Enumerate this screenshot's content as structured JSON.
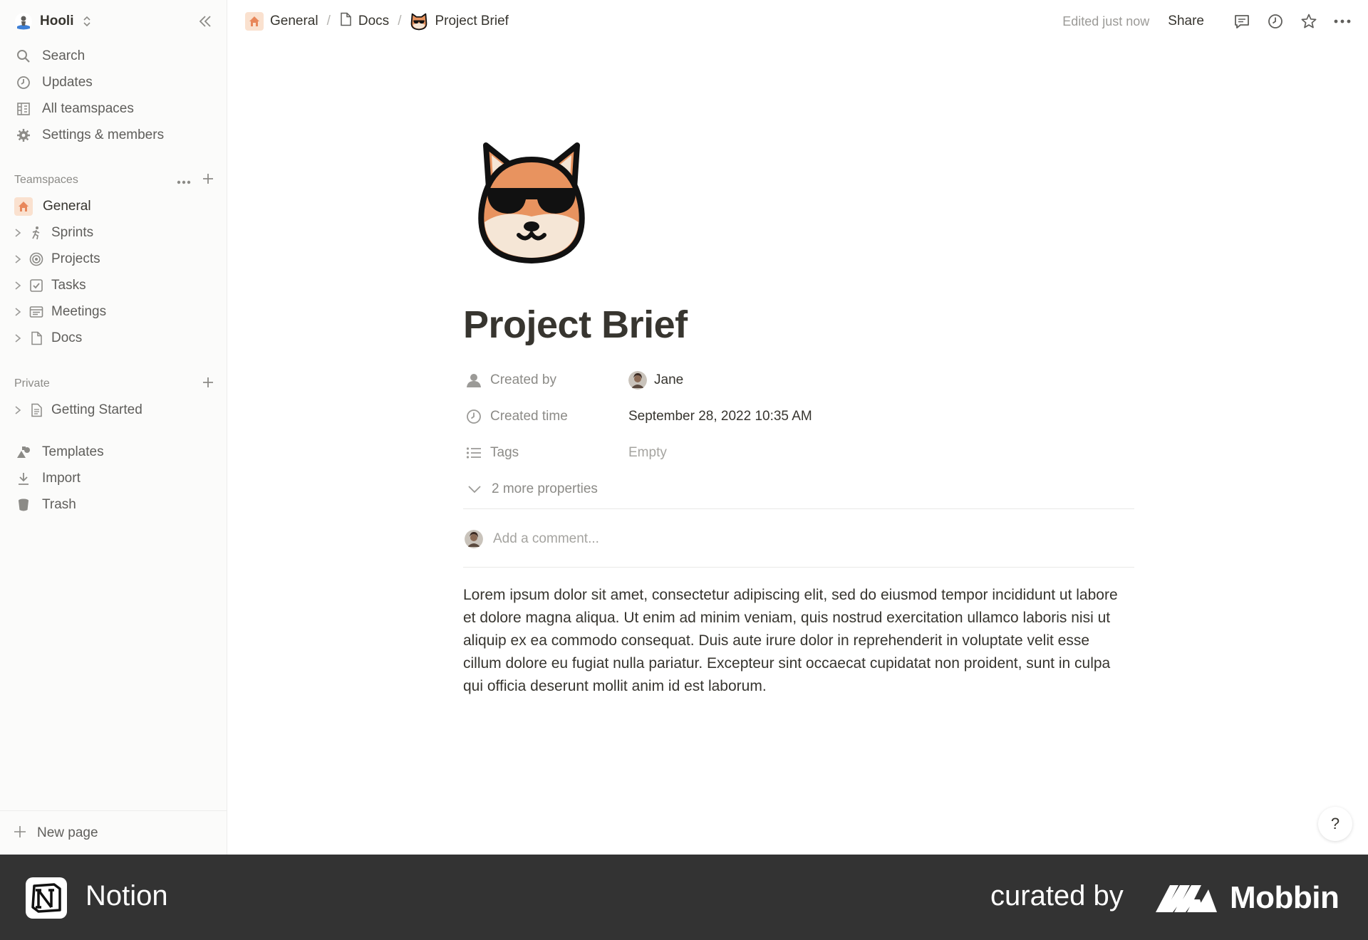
{
  "workspace": {
    "name": "Hooli"
  },
  "sidebar": {
    "nav": [
      {
        "label": "Search",
        "icon": "search-icon"
      },
      {
        "label": "Updates",
        "icon": "clock-icon"
      },
      {
        "label": "All teamspaces",
        "icon": "building-icon"
      },
      {
        "label": "Settings & members",
        "icon": "gear-icon"
      }
    ],
    "teamspaces_label": "Teamspaces",
    "teamspaces": [
      {
        "label": "General",
        "icon": "home-icon",
        "active": true
      },
      {
        "label": "Sprints",
        "icon": "runner-icon"
      },
      {
        "label": "Projects",
        "icon": "target-icon"
      },
      {
        "label": "Tasks",
        "icon": "checkbox-icon"
      },
      {
        "label": "Meetings",
        "icon": "notes-icon"
      },
      {
        "label": "Docs",
        "icon": "page-icon"
      }
    ],
    "private_label": "Private",
    "private": [
      {
        "label": "Getting Started",
        "icon": "doc-icon"
      }
    ],
    "bottom": [
      {
        "label": "Templates",
        "icon": "shapes-icon"
      },
      {
        "label": "Import",
        "icon": "download-icon"
      },
      {
        "label": "Trash",
        "icon": "trash-icon"
      }
    ],
    "new_page": "New page"
  },
  "topbar": {
    "breadcrumbs": [
      "General",
      "Docs",
      "Project Brief"
    ],
    "edited": "Edited just now",
    "share": "Share"
  },
  "page": {
    "title": "Project Brief",
    "properties": [
      {
        "key": "Created by",
        "value": "Jane",
        "icon": "person-icon"
      },
      {
        "key": "Created time",
        "value": "September 28, 2022 10:35 AM",
        "icon": "clock-icon"
      },
      {
        "key": "Tags",
        "value": "Empty",
        "icon": "list-icon"
      }
    ],
    "more_properties": "2 more properties",
    "comment_placeholder": "Add a comment...",
    "body": "Lorem ipsum dolor sit amet, consectetur adipiscing elit, sed do eiusmod tempor incididunt ut labore et dolore magna aliqua. Ut enim ad minim veniam, quis nostrud exercitation ullamco laboris nisi ut aliquip ex ea commodo consequat. Duis aute irure dolor in reprehenderit in voluptate velit esse cillum dolore eu fugiat nulla pariatur. Excepteur sint occaecat cupidatat non proident, sunt in culpa qui officia deserunt mollit anim id est laborum."
  },
  "help": "?",
  "footer": {
    "app_name": "Notion",
    "curated_by": "curated by",
    "brand": "Mobbin"
  },
  "colors": {
    "sidebar_bg": "#fbfbfa",
    "accent_orange": "#e8875a",
    "footer_bg": "#333333",
    "text": "#37352f",
    "muted": "#8c8b87"
  }
}
